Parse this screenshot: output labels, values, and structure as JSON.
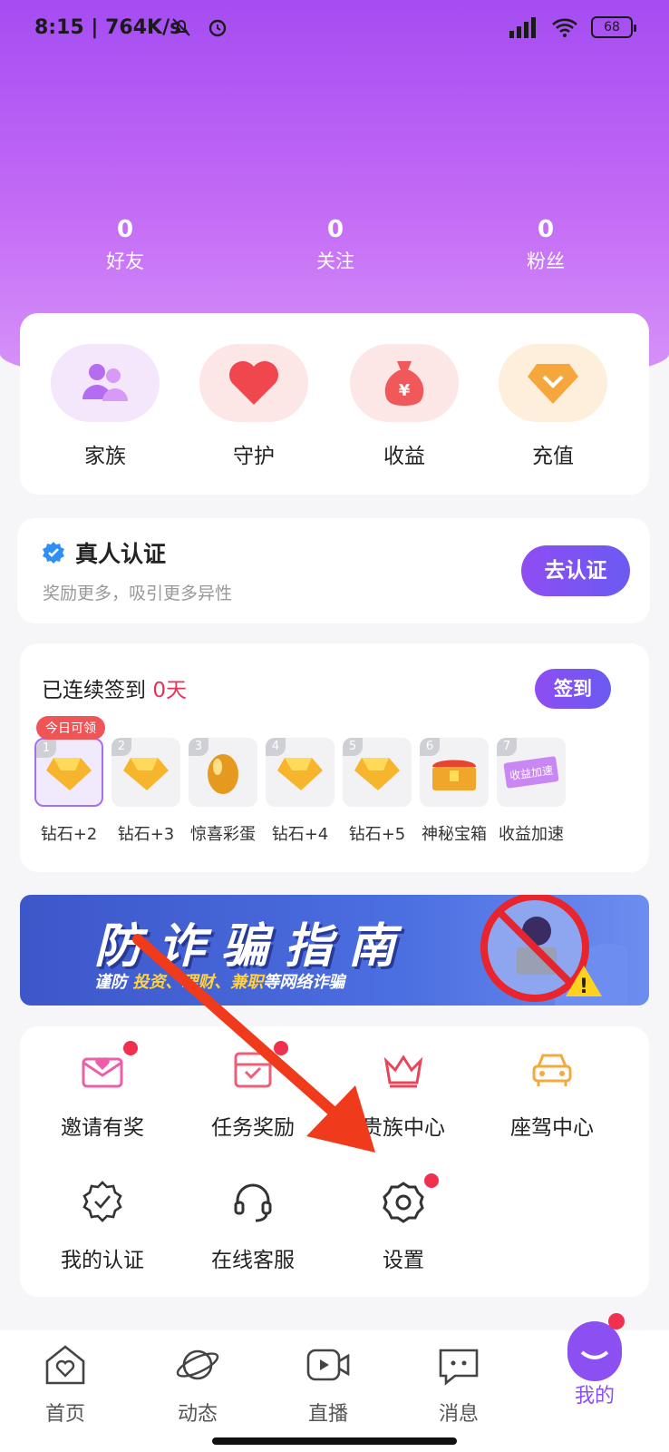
{
  "status": {
    "time": "8:15",
    "speed": "764K/s",
    "battery": "68"
  },
  "stats": [
    {
      "value": "0",
      "label": "好友"
    },
    {
      "value": "0",
      "label": "关注"
    },
    {
      "value": "0",
      "label": "粉丝"
    }
  ],
  "quick": [
    {
      "label": "家族",
      "icon": "family-icon",
      "bg": "#f4e6fb"
    },
    {
      "label": "守护",
      "icon": "heart-icon",
      "bg": "#fde6e6"
    },
    {
      "label": "收益",
      "icon": "money-bag-icon",
      "bg": "#fde6e6"
    },
    {
      "label": "充值",
      "icon": "diamond-icon",
      "bg": "#fdefdc"
    }
  ],
  "verify": {
    "title": "真人认证",
    "subtitle": "奖励更多，吸引更多异性",
    "button": "去认证"
  },
  "signin": {
    "title_prefix": "已连续签到 ",
    "days": "0天",
    "button": "签到",
    "today_tag": "今日可领",
    "items": [
      {
        "index": "1",
        "label": "钻石+2"
      },
      {
        "index": "2",
        "label": "钻石+3"
      },
      {
        "index": "3",
        "label": "惊喜彩蛋"
      },
      {
        "index": "4",
        "label": "钻石+4"
      },
      {
        "index": "5",
        "label": "钻石+5"
      },
      {
        "index": "6",
        "label": "神秘宝箱"
      },
      {
        "index": "7",
        "label": "收益加速"
      }
    ],
    "ticket_text": "收益加速"
  },
  "banner": {
    "title": "防诈骗指南",
    "sub_prefix": "谨防 ",
    "sub_highlight": "投资、理财、兼职",
    "sub_suffix": "等网络诈骗"
  },
  "menu": [
    {
      "label": "邀请有奖",
      "icon": "invite-envelope-icon",
      "dot": true
    },
    {
      "label": "任务奖励",
      "icon": "task-reward-icon",
      "dot": true
    },
    {
      "label": "贵族中心",
      "icon": "crown-icon",
      "dot": false
    },
    {
      "label": "座驾中心",
      "icon": "car-icon",
      "dot": false
    },
    {
      "label": "我的认证",
      "icon": "certified-badge-icon",
      "dot": false
    },
    {
      "label": "在线客服",
      "icon": "headset-icon",
      "dot": false
    },
    {
      "label": "设置",
      "icon": "gear-icon",
      "dot": true
    }
  ],
  "tabs": [
    {
      "label": "首页",
      "icon": "home-icon"
    },
    {
      "label": "动态",
      "icon": "planet-icon"
    },
    {
      "label": "直播",
      "icon": "video-icon"
    },
    {
      "label": "消息",
      "icon": "chat-icon"
    },
    {
      "label": "我的",
      "icon": "profile-icon"
    }
  ],
  "colors": {
    "accent": "#8f4cf2",
    "red": "#e6335a",
    "hero_top": "#a54cf2"
  }
}
